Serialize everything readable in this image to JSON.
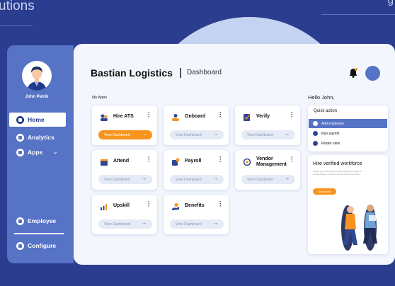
{
  "background": {
    "title": "utions",
    "right_text": "g"
  },
  "user": {
    "name": "John Patrik"
  },
  "nav": {
    "items": [
      {
        "label": "Home"
      },
      {
        "label": "Analytics"
      },
      {
        "label": "Apps"
      }
    ],
    "bottom": [
      {
        "label": "Employee"
      },
      {
        "label": "Configure"
      }
    ]
  },
  "header": {
    "title": "Bastian Logistics",
    "subtitle": "Dashboard"
  },
  "apps_label": "My Apps",
  "apps": [
    {
      "name": "Hire ATS",
      "button": "View Dashboard"
    },
    {
      "name": "Onboard",
      "button": "View Dashboard"
    },
    {
      "name": "Verify",
      "button": "View Dashboard"
    },
    {
      "name": "Attend",
      "button": "View Dashboard"
    },
    {
      "name": "Payroll",
      "button": "View Dashboard"
    },
    {
      "name": "Vendor Management",
      "button": "View Dashboard"
    },
    {
      "name": "Upskill",
      "button": "View Dashboard"
    },
    {
      "name": "Benefits",
      "button": "View Dashboard"
    }
  ],
  "greeting": "Hello John,",
  "quick_action": {
    "title": "Quick action",
    "items": [
      "Add employee",
      "Run payroll",
      "Roster view"
    ]
  },
  "promo": {
    "title": "Hire verified workforce",
    "text": "Create your first verified profile. Verification helps to onboard faster and keep your workforce compliant.",
    "button": "Subscribe"
  },
  "colors": {
    "accent": "#f7941d",
    "brand": "#2b3d8f",
    "sidebar": "#5673c6"
  }
}
